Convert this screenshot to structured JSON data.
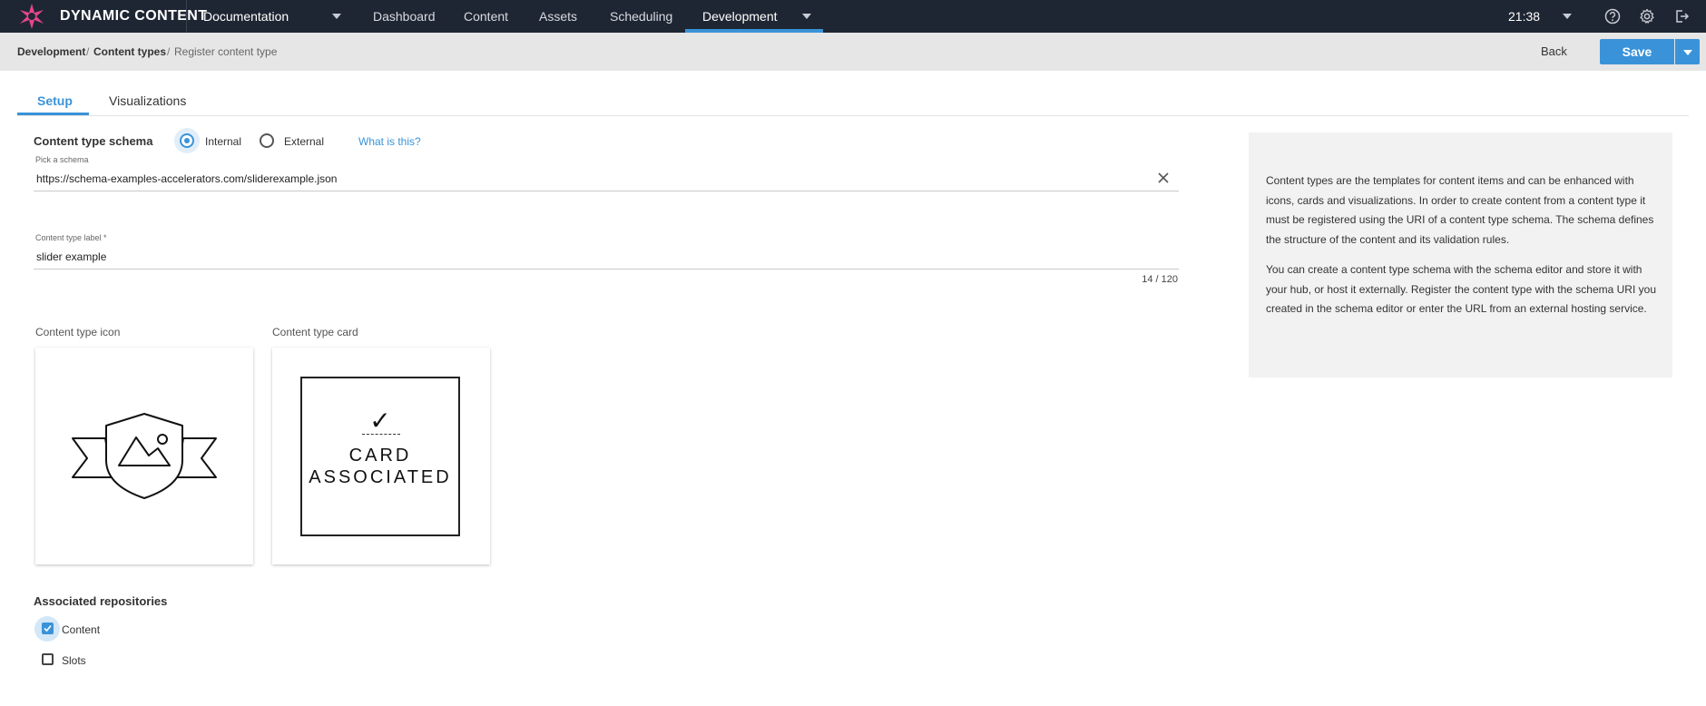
{
  "topbar": {
    "brand": "DYNAMIC CONTENT",
    "hub_name": "Documentation",
    "nav": [
      "Dashboard",
      "Content",
      "Assets",
      "Scheduling",
      "Development"
    ],
    "active_nav": "Development",
    "clock": "21:38",
    "icons": [
      "help-icon",
      "settings-icon",
      "logout-icon"
    ],
    "accent_color": "#3a93d8",
    "bar_color": "#1f2633"
  },
  "breadcrumb": {
    "items": [
      "Development",
      "Content types",
      "Register content type"
    ],
    "separator": "/"
  },
  "actions": {
    "back_label": "Back",
    "save_label": "Save"
  },
  "tabs": [
    "Setup",
    "Visualizations"
  ],
  "active_tab": "Setup",
  "schema": {
    "section_title": "Content type schema",
    "options": [
      "Internal",
      "External"
    ],
    "selected": "Internal",
    "help_link": "What is this?",
    "pick_label": "Pick a schema",
    "pick_value": "https://schema-examples-accelerators.com/sliderexample.json"
  },
  "label_field": {
    "label": "Content type label *",
    "value": "slider example",
    "counter": "14 / 120"
  },
  "icon_section": {
    "label": "Content type icon"
  },
  "card_section": {
    "label": "Content type card",
    "check": "✓",
    "line1": "CARD",
    "line2": "ASSOCIATED"
  },
  "repositories": {
    "title": "Associated repositories",
    "items": [
      {
        "label": "Content",
        "checked": true
      },
      {
        "label": "Slots",
        "checked": false
      }
    ]
  },
  "info": {
    "paragraphs": [
      "Content types are the templates for content items and can be enhanced with icons, cards and visualizations. In order to create content from a content type it must be registered using the URI of a content type schema. The schema defines the structure of the content and its validation rules.",
      "You can create a content type schema with the schema editor and store it with your hub, or host it externally. Register the content type with the schema URI you created in the schema editor or enter the URL from an external hosting service."
    ]
  }
}
